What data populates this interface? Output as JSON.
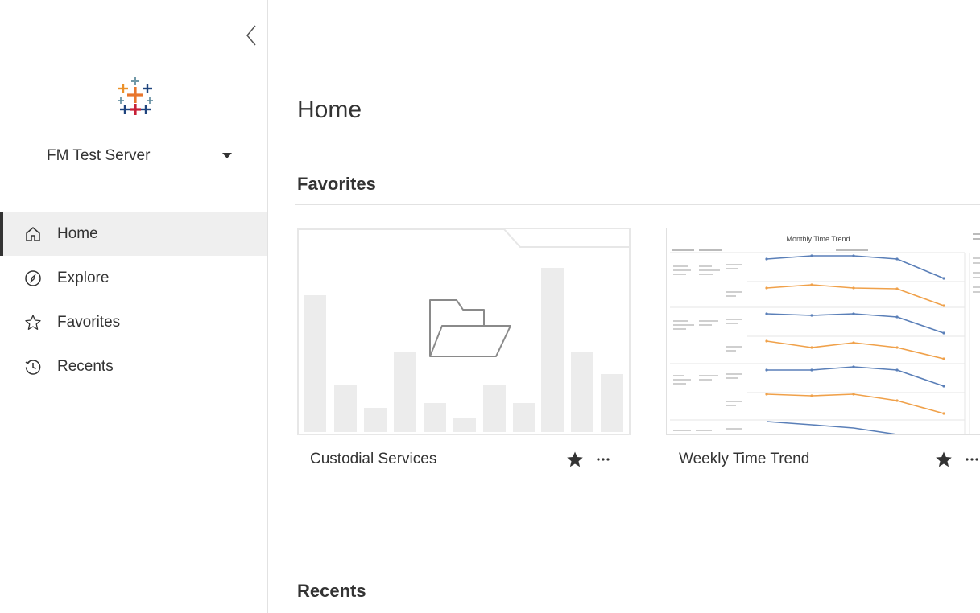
{
  "sidebar": {
    "collapse_label": "‹",
    "site_name": "FM Test Server",
    "nav": [
      {
        "label": "Home",
        "icon": "home-icon",
        "active": true
      },
      {
        "label": "Explore",
        "icon": "compass-icon",
        "active": false
      },
      {
        "label": "Favorites",
        "icon": "star-outline-icon",
        "active": false
      },
      {
        "label": "Recents",
        "icon": "history-icon",
        "active": false
      }
    ]
  },
  "main": {
    "title": "Home",
    "favorites_title": "Favorites",
    "recents_title": "Recents",
    "favorites": [
      {
        "name": "Custodial Services",
        "type": "project",
        "favorited": true
      },
      {
        "name": "Weekly Time Trend",
        "type": "workbook",
        "favorited": true,
        "thumbnail_title": "Monthly Time Trend"
      }
    ]
  },
  "colors": {
    "logo": [
      "#e8762d",
      "#c72037",
      "#5b879b",
      "#1f447e",
      "#eb9129",
      "#59879b"
    ],
    "series_blue": "#5a7fb8",
    "series_orange": "#f0a14a",
    "nav_active_bg": "#efefef"
  }
}
